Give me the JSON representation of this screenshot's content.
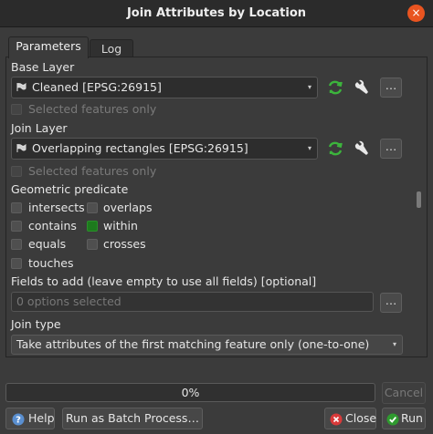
{
  "window": {
    "title": "Join Attributes by Location",
    "close_glyph": "×"
  },
  "tabs": [
    {
      "label": "Parameters"
    },
    {
      "label": "Log"
    }
  ],
  "base_layer": {
    "label": "Base Layer",
    "value": "Cleaned [EPSG:26915]",
    "selected_only": "Selected features only",
    "dots": "…"
  },
  "join_layer": {
    "label": "Join Layer",
    "value": "Overlapping rectangles [EPSG:26915]",
    "selected_only": "Selected features only",
    "dots": "…"
  },
  "predicate": {
    "label": "Geometric predicate",
    "options": [
      {
        "label": "intersects",
        "checked": false
      },
      {
        "label": "overlaps",
        "checked": false
      },
      {
        "label": "contains",
        "checked": false
      },
      {
        "label": "within",
        "checked": true
      },
      {
        "label": "equals",
        "checked": false
      },
      {
        "label": "crosses",
        "checked": false
      },
      {
        "label": "touches",
        "checked": false
      }
    ]
  },
  "fields": {
    "label": "Fields to add (leave empty to use all fields) [optional]",
    "placeholder": "0 options selected",
    "dots": "…"
  },
  "join_type": {
    "label": "Join type",
    "value": "Take attributes of the first matching feature only (one-to-one)"
  },
  "progress": {
    "value": 0,
    "text": "0%"
  },
  "buttons": {
    "cancel": "Cancel",
    "help": "Help",
    "batch": "Run as Batch Process…",
    "close": "Close",
    "run": "Run"
  },
  "colors": {
    "accent": "#e95420",
    "checked": "#1d7a1d",
    "refresh_icon": "#3cb43c"
  }
}
